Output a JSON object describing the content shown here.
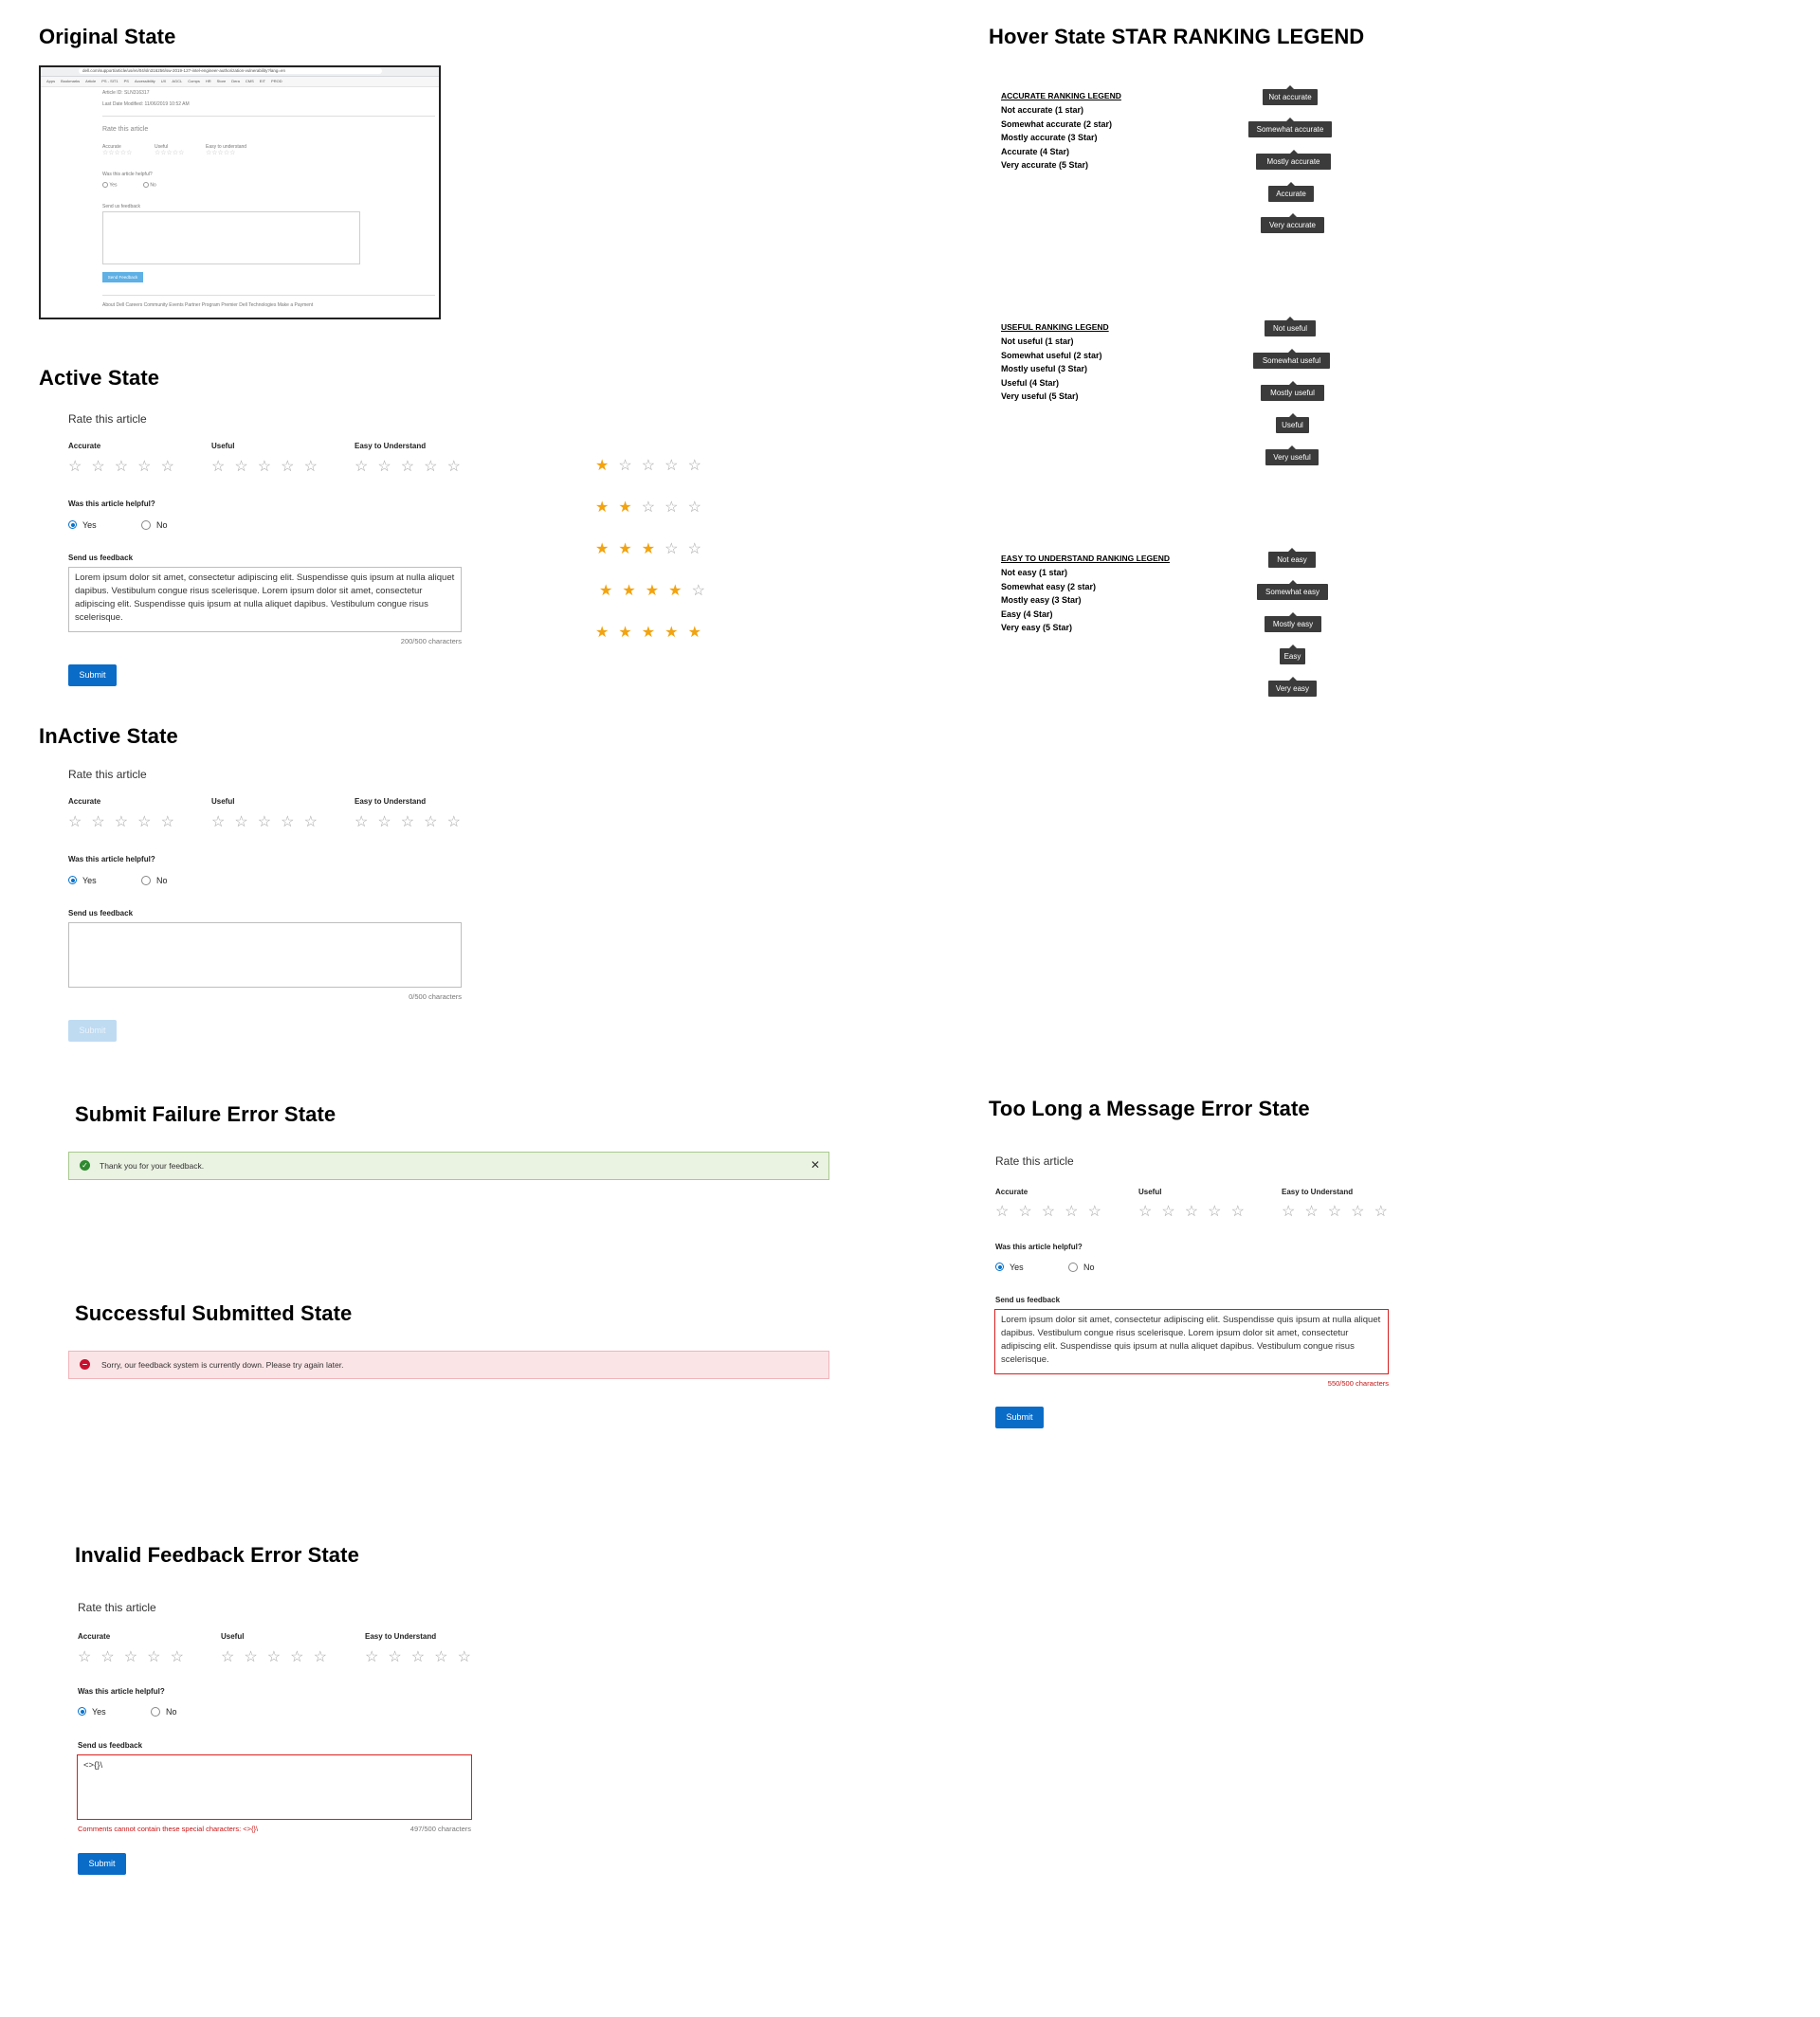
{
  "sections": {
    "original": "Original State",
    "active": "Active State",
    "inactive": "InActive State",
    "hover": "Hover State STAR RANKING LEGEND",
    "submit_failure": "Submit Failure Error State",
    "success": "Successful Submitted State",
    "too_long": "Too Long a Message Error State",
    "invalid": "Invalid Feedback Error State"
  },
  "thumb": {
    "url": "dell.com/support/article/us/en/04/sln316256/sw-2019-127-intel-engineer-authorization-vulnerability?lang=en",
    "bookmarks": [
      "Apps",
      "Bookmarks",
      "Article",
      "PS - SIT1",
      "PS",
      "Accessibility",
      "UX",
      "AGCL",
      "Comps",
      "HR",
      "Store",
      "Dera",
      "CMS",
      "EIT",
      "PROD"
    ],
    "meta1": "Article ID: SLN316317",
    "meta2": "Last Date Modified: 11/06/2019 10:52 AM",
    "rate": "Rate this article",
    "accurate": "Accurate",
    "useful": "Useful",
    "easy": "Easy to understand",
    "helpful": "Was this article helpful?",
    "yes": "Yes",
    "no": "No",
    "feedback": "Send us feedback",
    "button": "Send Feedback",
    "footer": "About Dell   Careers   Community   Events   Partner Program   Premier   Dell Technologies   Make a Payment"
  },
  "form": {
    "rate_title": "Rate this article",
    "accurate": "Accurate",
    "useful": "Useful",
    "easy": "Easy to Understand",
    "helpful": "Was this article helpful?",
    "yes": "Yes",
    "no": "No",
    "feedback_label": "Send us feedback",
    "submit": "Submit"
  },
  "active": {
    "text": "Lorem ipsum dolor sit amet, consectetur adipiscing elit. Suspendisse quis ipsum at nulla aliquet dapibus. Vestibulum congue risus scelerisque. Lorem ipsum dolor sit amet, consectetur adipiscing elit. Suspendisse quis ipsum at nulla aliquet dapibus. Vestibulum congue risus scelerisque.",
    "count": "200/500 characters",
    "star_rows": [
      1,
      2,
      3,
      4,
      5
    ]
  },
  "inactive": {
    "count": "0/500 characters"
  },
  "legends": {
    "accurate": {
      "title": "ACCURATE RANKING LEGEND",
      "items": [
        "Not accurate (1 star)",
        "Somewhat accurate (2 star)",
        "Mostly accurate  (3 Star)",
        "Accurate  (4 Star)",
        "Very accurate (5 Star)"
      ],
      "tips": [
        "Not accurate",
        "Somewhat accurate",
        "Mostly accurate",
        "Accurate",
        "Very accurate"
      ]
    },
    "useful": {
      "title": "USEFUL RANKING LEGEND",
      "items": [
        "Not useful (1 star)",
        "Somewhat useful (2 star)",
        "Mostly useful (3 Star)",
        "Useful (4 Star)",
        "Very useful (5 Star)"
      ],
      "tips": [
        "Not useful",
        "Somewhat useful",
        "Mostly useful",
        "Useful",
        "Very useful"
      ]
    },
    "easy": {
      "title": "EASY TO UNDERSTAND RANKING LEGEND",
      "items": [
        "Not easy (1 star)",
        "Somewhat easy (2 star)",
        "Mostly easy (3 Star)",
        "Easy (4 Star)",
        "Very easy (5 Star)"
      ],
      "tips": [
        "Not easy",
        "Somewhat easy",
        "Mostly easy",
        "Easy",
        "Very easy"
      ]
    }
  },
  "alerts": {
    "success_text": "Thank you for your feedback.",
    "error_text": "Sorry, our feedback system is currently down. Please try again later."
  },
  "too_long": {
    "text": "Lorem ipsum dolor sit amet, consectetur adipiscing elit. Suspendisse quis ipsum at nulla aliquet dapibus. Vestibulum congue risus scelerisque. Lorem ipsum dolor sit amet, consectetur adipiscing elit. Suspendisse quis ipsum at nulla aliquet dapibus. Vestibulum congue risus scelerisque.",
    "count": "550/500 characters"
  },
  "invalid": {
    "text": "<>{}\\",
    "error": "Comments cannot contain these special characters: <>{}\\",
    "count": "497/500 characters"
  },
  "colors": {
    "primary": "#0b6cc7",
    "star_active": "#f2a30f",
    "star_inactive": "#a6a6a6",
    "error": "#d71f1f",
    "success_bg": "#eaf2e2",
    "error_bg": "#fbe4e6",
    "tooltip": "#3b3b3b"
  },
  "icons": {
    "star": "star-icon",
    "check": "check-circle-icon",
    "error": "error-circle-icon",
    "close": "close-icon"
  }
}
